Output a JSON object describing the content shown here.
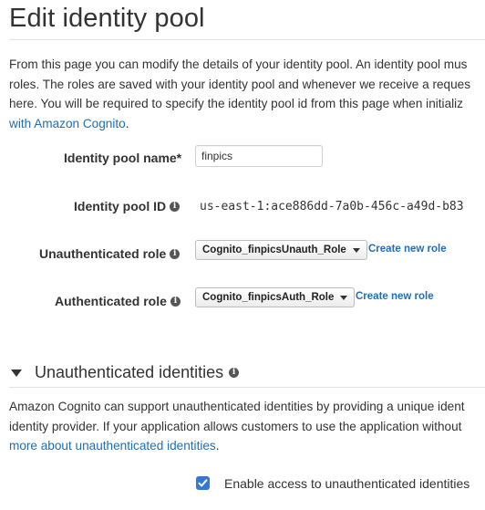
{
  "page": {
    "title": "Edit identity pool",
    "intro_lines": [
      "From this page you can modify the details of your identity pool. An identity pool mus",
      "roles. The roles are saved with your identity pool and whenever we receive a reques",
      "here. You will be required to specify the identity pool id from this page when initializ"
    ],
    "intro_link": "with Amazon Cognito",
    "intro_link_suffix": "."
  },
  "form": {
    "pool_name_label": "Identity pool name*",
    "pool_name_value": "finpics",
    "pool_id_label": "Identity pool ID",
    "pool_id_value": "us-east-1:ace886dd-7a0b-456c-a49d-b83",
    "unauth_role_label": "Unauthenticated role",
    "unauth_role_value": "Cognito_finpicsUnauth_Role",
    "auth_role_label": "Authenticated role",
    "auth_role_value": "Cognito_finpicsAuth_Role",
    "create_role_link": "Create new role",
    "info_icon_glyph": "i"
  },
  "unauth_section": {
    "heading": "Unauthenticated identities",
    "desc_lines": [
      "Amazon Cognito can support unauthenticated identities by providing a unique ident",
      "identity provider. If your application allows customers to use the application without"
    ],
    "desc_link": "more about unauthenticated identities",
    "desc_link_suffix": ".",
    "checkbox_label": "Enable access to unauthenticated identities",
    "checkbox_checked": true
  },
  "colors": {
    "link": "#1f6fb7",
    "checkbox": "#3478d6"
  }
}
